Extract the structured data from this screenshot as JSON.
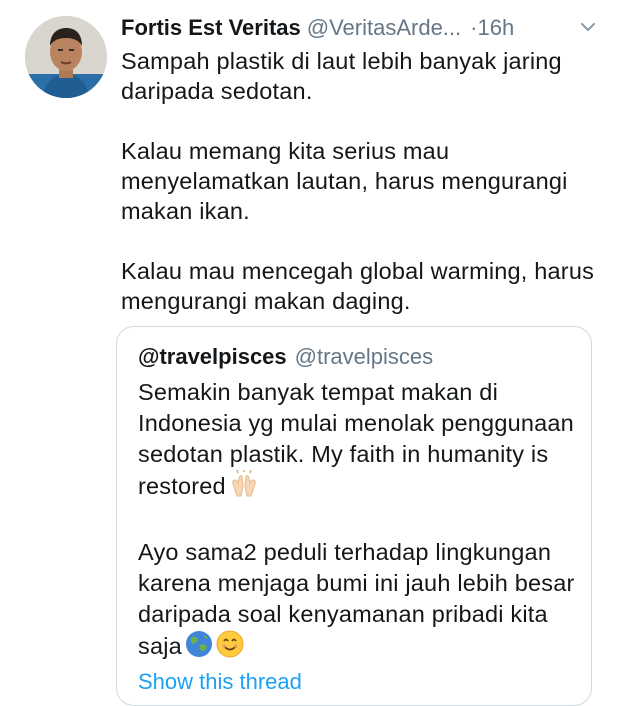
{
  "tweet": {
    "author_name": "Fortis Est Veritas",
    "author_handle": "@VeritasArde...",
    "separator": "·",
    "time": "16h",
    "text": "Sampah plastik di laut lebih banyak jaring daripada sedotan.\n\nKalau memang kita serius mau menyelamatkan lautan, harus mengurangi makan ikan.\n\nKalau mau mencegah global warming, harus mengurangi makan daging.",
    "icons": {
      "avatar": "user-avatar",
      "menu": "chevron-down-icon"
    }
  },
  "quoted": {
    "author_name": "@travelpisces",
    "author_handle": "@travelpisces",
    "paragraph1": "Semakin banyak tempat makan di Indonesia yg mulai menolak penggunaan sedotan plastik. My faith in humanity is restored",
    "paragraph2": "Ayo sama2 peduli terhadap lingkungan karena menjaga bumi ini jauh lebih besar daripada soal kenyamanan pribadi kita saja",
    "emoji1": "raising-hands-emoji",
    "emoji2": [
      "earth-globe-emoji",
      "smiling-face-emoji"
    ],
    "show_thread": "Show this thread"
  },
  "colors": {
    "text": "#14171a",
    "secondary": "#657786",
    "link": "#1da1f2",
    "border": "#cfd9de"
  }
}
